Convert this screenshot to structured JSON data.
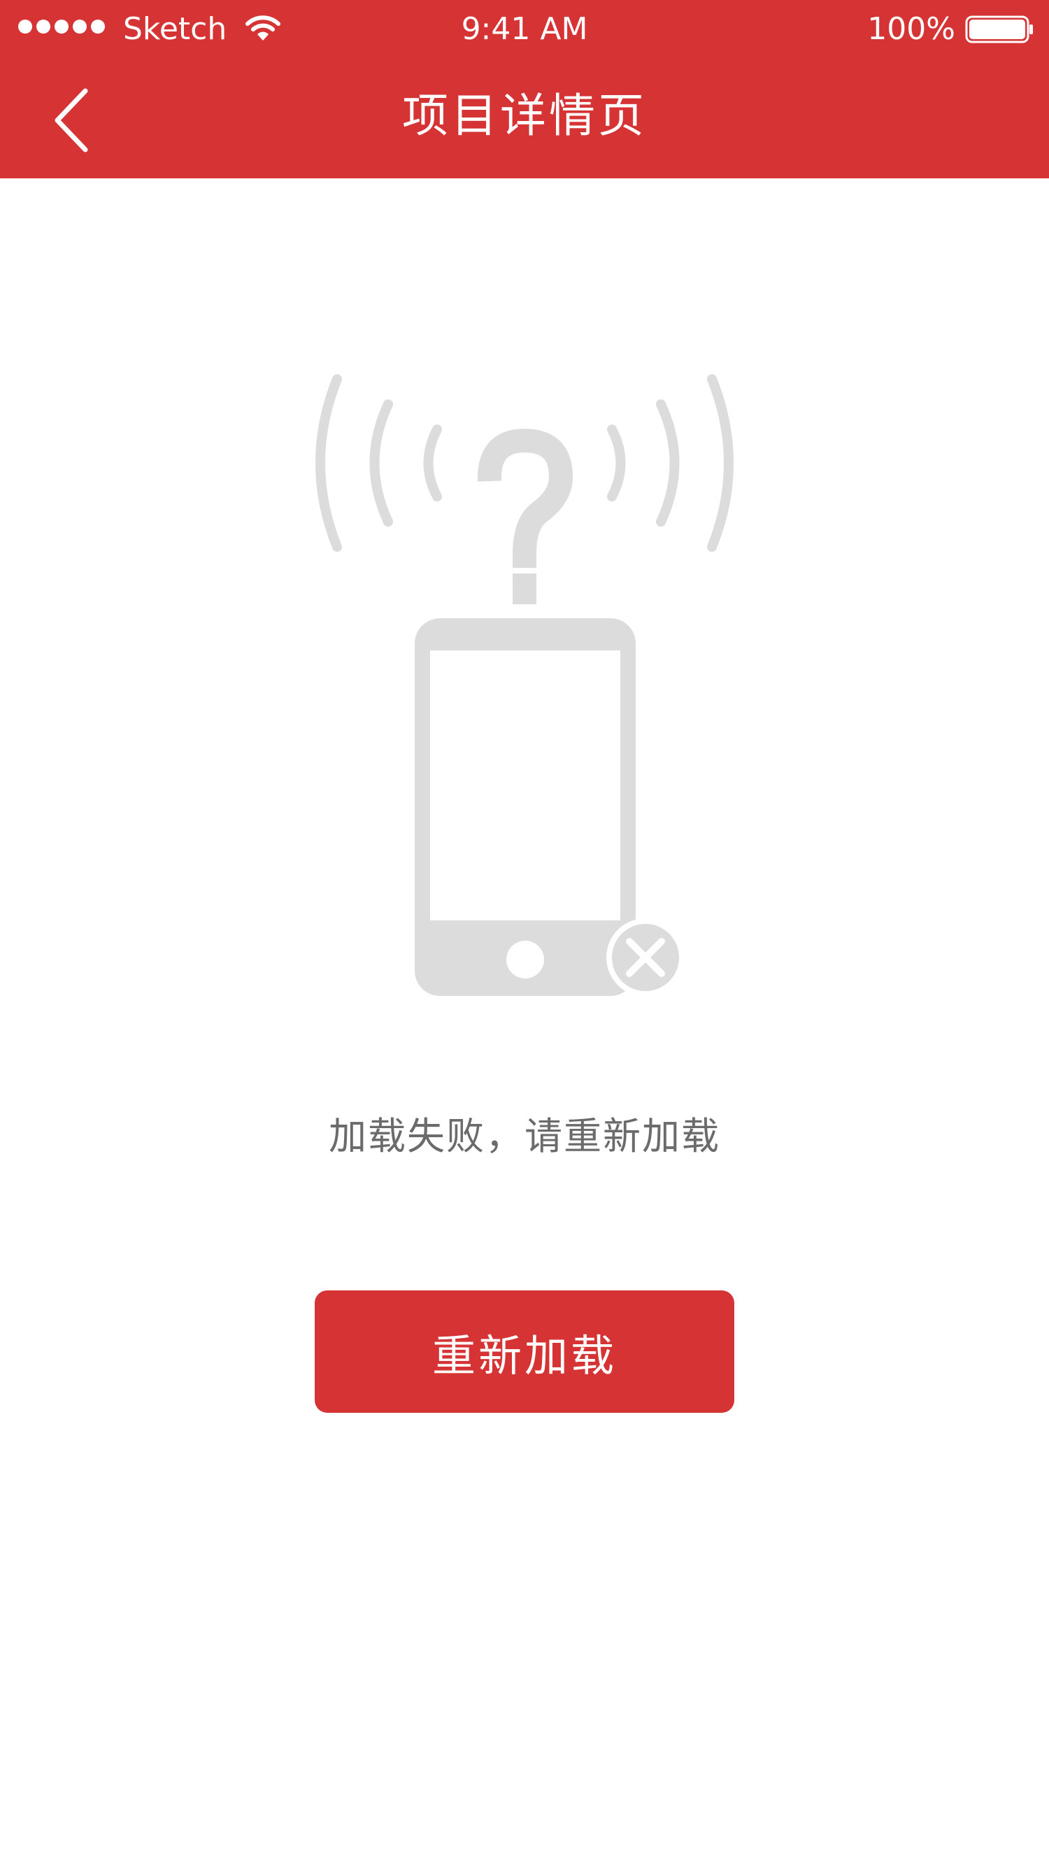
{
  "status_bar": {
    "carrier": "Sketch",
    "time": "9:41 AM",
    "battery_percent": "100%",
    "signal_icon": "signal-dots-icon",
    "wifi_icon": "wifi-icon",
    "battery_icon": "battery-full-icon"
  },
  "nav": {
    "title": "项目详情页",
    "back_icon": "chevron-left-icon"
  },
  "empty_state": {
    "illustration": "phone-no-signal-illustration",
    "message": "加载失败，请重新加载"
  },
  "actions": {
    "reload_label": "重新加载"
  },
  "colors": {
    "brand_red": "#d63334",
    "illustration_gray": "#dcdcdc",
    "message_gray": "#6b6b6b",
    "background": "#ffffff"
  }
}
